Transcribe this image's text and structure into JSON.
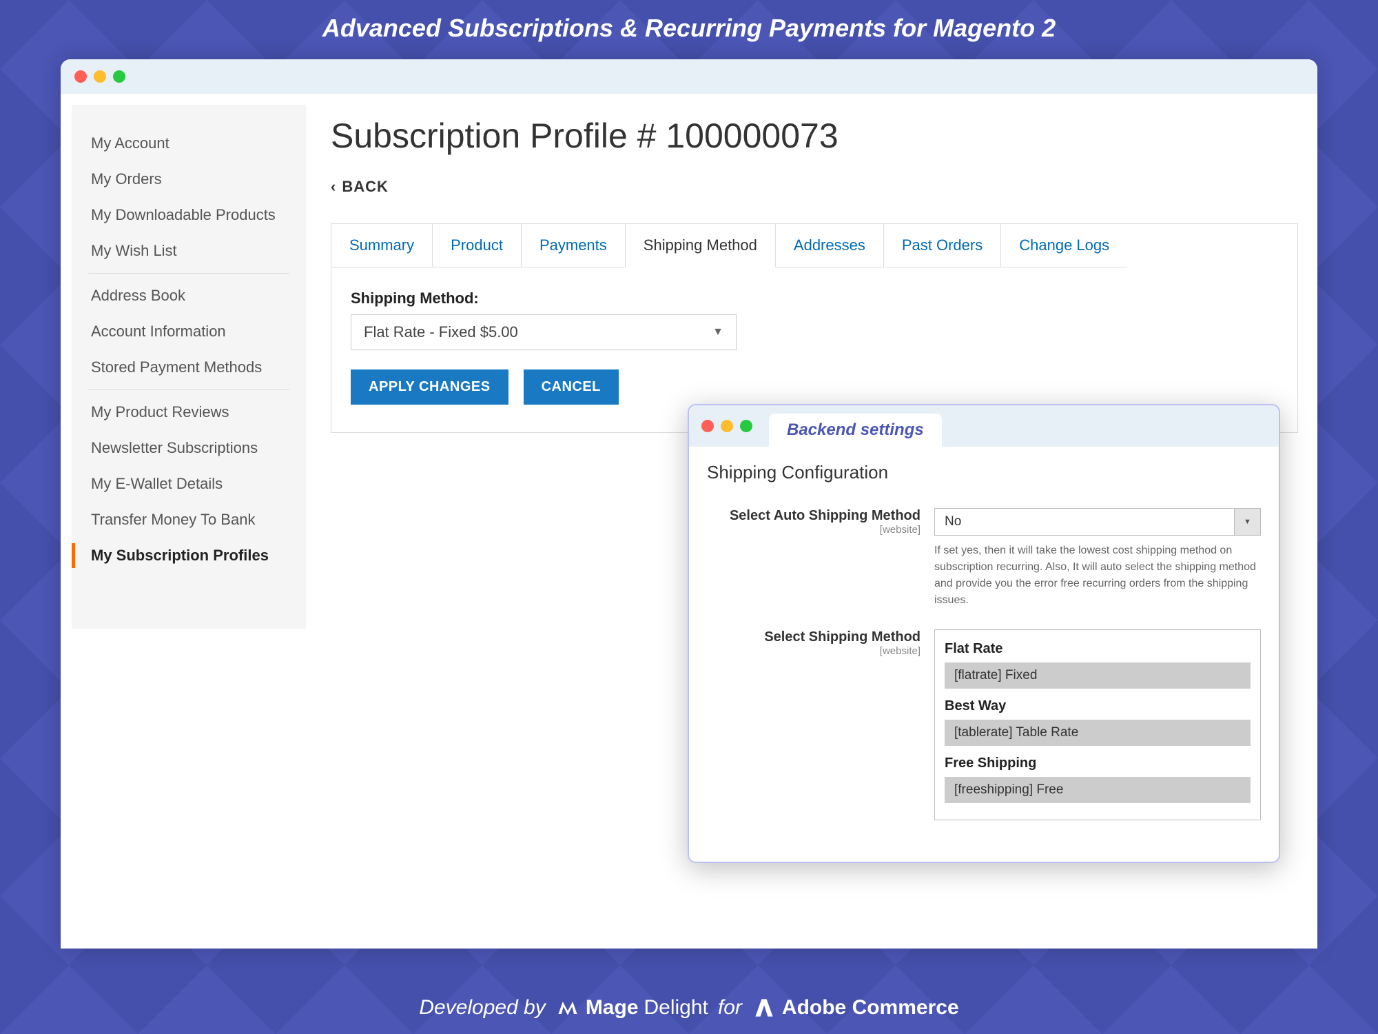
{
  "banner": "Advanced Subscriptions & Recurring Payments for Magento 2",
  "sidebar": {
    "groups": [
      [
        "My Account",
        "My Orders",
        "My Downloadable Products",
        "My Wish List"
      ],
      [
        "Address Book",
        "Account Information",
        "Stored Payment Methods"
      ],
      [
        "My Product Reviews",
        "Newsletter Subscriptions",
        "My E-Wallet Details",
        "Transfer Money To Bank",
        "My Subscription Profiles"
      ]
    ],
    "active": "My Subscription Profiles"
  },
  "page": {
    "title": "Subscription Profile # 100000073",
    "back": "BACK"
  },
  "tabs": [
    "Summary",
    "Product",
    "Payments",
    "Shipping Method",
    "Addresses",
    "Past Orders",
    "Change Logs"
  ],
  "active_tab": "Shipping Method",
  "shipping": {
    "label": "Shipping Method:",
    "value": "Flat Rate - Fixed $5.00",
    "apply": "APPLY CHANGES",
    "cancel": "CANCEL"
  },
  "backend": {
    "title": "Backend settings",
    "heading": "Shipping Configuration",
    "auto": {
      "label": "Select Auto Shipping Method",
      "scope": "[website]",
      "value": "No",
      "help": "If set yes, then it will take the lowest cost shipping method on subscription recurring. Also, It will auto select the shipping method and provide you the error free recurring orders from the shipping issues."
    },
    "select_method": {
      "label": "Select Shipping Method",
      "scope": "[website]",
      "groups": [
        {
          "title": "Flat Rate",
          "option": "[flatrate] Fixed"
        },
        {
          "title": "Best Way",
          "option": "[tablerate] Table Rate"
        },
        {
          "title": "Free Shipping",
          "option": "[freeshipping] Free"
        }
      ]
    }
  },
  "footer": {
    "developed": "Developed by",
    "brand1a": "Mage",
    "brand1b": "Delight",
    "for": "for",
    "brand2": "Adobe Commerce"
  }
}
